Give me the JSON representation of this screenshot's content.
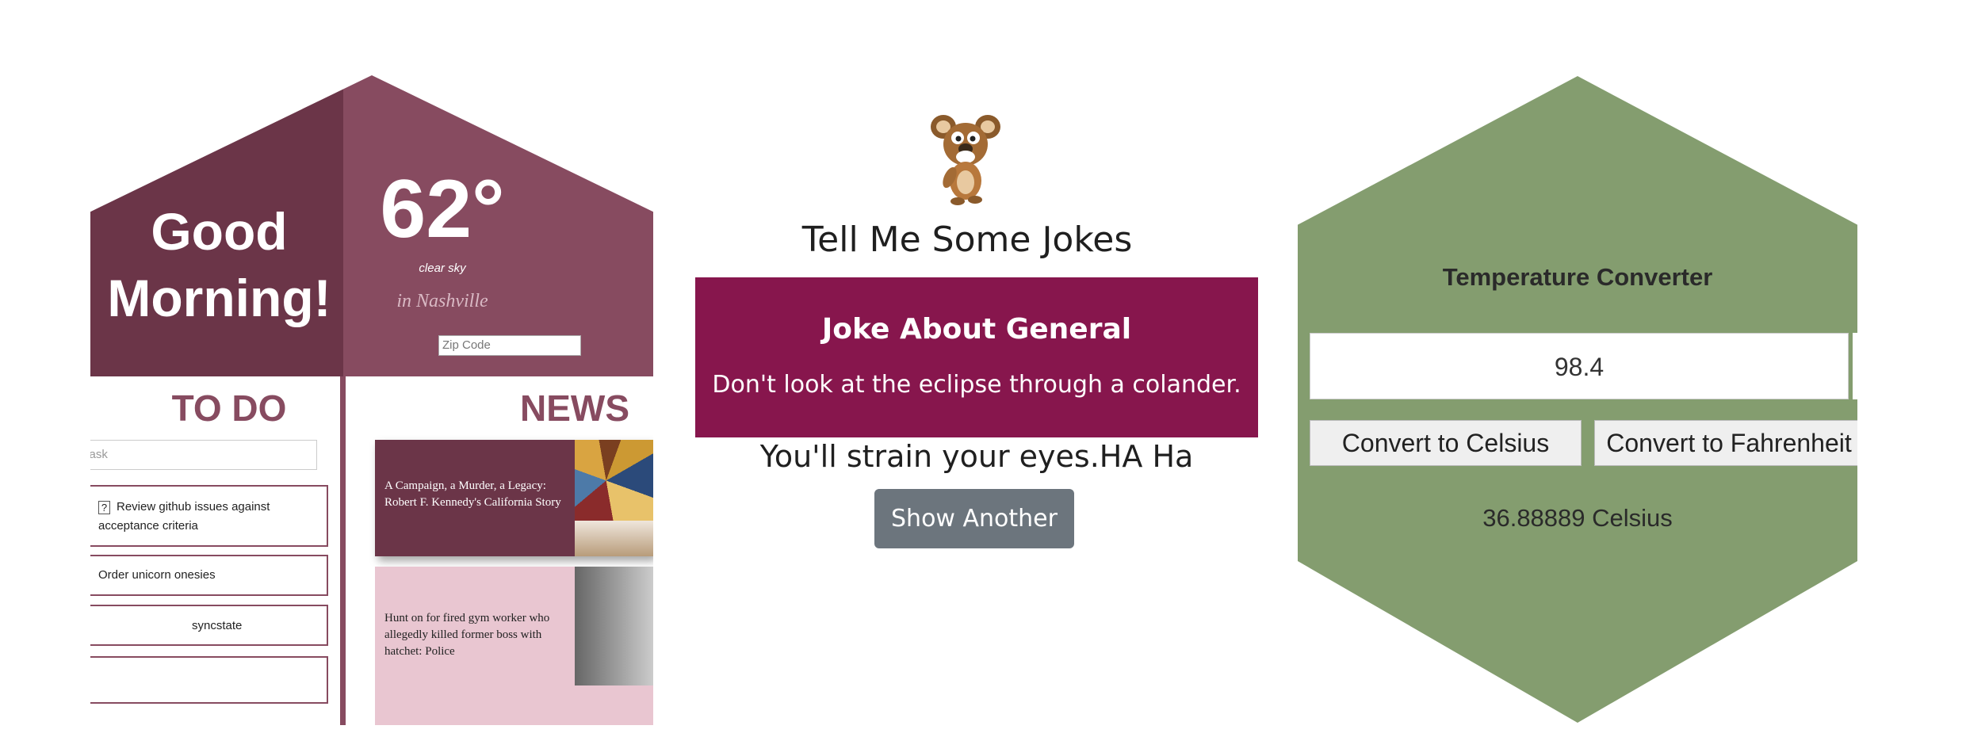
{
  "dashboard": {
    "greeting": "Good Morning!",
    "temperature": "62°",
    "condition": "clear sky",
    "location": "in Nashville",
    "zip_placeholder": "Zip Code",
    "todo": {
      "title": "TO DO",
      "task_placeholder": "Task",
      "items": [
        "Review github issues against acceptance criteria",
        "Order unicorn onesies",
        "syncstate"
      ]
    },
    "news": {
      "title": "NEWS",
      "articles": [
        "A Campaign, a Murder, a Legacy: Robert F. Kennedy's California Story",
        "Hunt on for fired gym worker who allegedly killed former boss with hatchet: Police"
      ]
    }
  },
  "jokes": {
    "title": "Tell Me Some Jokes",
    "heading": "Joke About General",
    "setup": "Don't look at the eclipse through a colander.",
    "punchline": "You'll strain your eyes.HA Ha",
    "button": "Show Another"
  },
  "converter": {
    "title": "Temperature Converter",
    "input_value": "98.4",
    "to_celsius": "Convert to Celsius",
    "to_fahrenheit": "Convert to Fahrenheit",
    "result": "36.88889 Celsius"
  },
  "colors": {
    "plum_dark": "#6b3548",
    "plum_light": "#874b60",
    "joke_box": "#87164d",
    "sage": "#849d6f",
    "button_gray": "#6c757d"
  }
}
